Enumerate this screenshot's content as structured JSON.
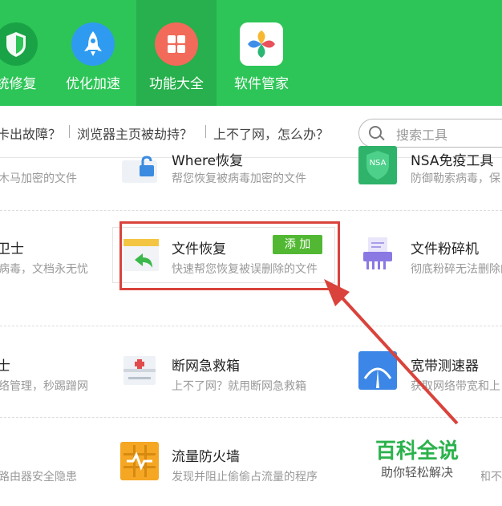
{
  "nav": {
    "items": [
      {
        "label": "统修复"
      },
      {
        "label": "优化加速"
      },
      {
        "label": "功能大全"
      },
      {
        "label": "软件管家"
      }
    ]
  },
  "quick_links": [
    "卡出故障？",
    "浏览器主页被劫持？",
    "上不了网，怎么办？"
  ],
  "search": {
    "placeholder": "搜索工具"
  },
  "tools": {
    "row0": {
      "left_desc": "木马加密的文件",
      "mid_name": "Where恢复",
      "mid_desc": "帮您恢复被病毒加密的文件",
      "right_name": "NSA免疫工具",
      "right_desc": "防御勒索病毒，保",
      "right_badge": "NSA"
    },
    "row1": {
      "left_name": "卫士",
      "left_desc": "病毒，文档永无忧",
      "mid_name": "文件恢复",
      "mid_desc": "快速帮您恢复被误删除的文件",
      "add_label": "添 加",
      "right_name": "文件粉碎机",
      "right_desc": "彻底粉碎无法删除的"
    },
    "row2": {
      "left_name": "士",
      "left_desc": "络管理，秒踢蹭网",
      "mid_name": "断网急救箱",
      "mid_desc": "上不了网？就用断网急救箱",
      "right_name": "宽带测速器",
      "right_desc": "获取网络带宽和上"
    },
    "row3": {
      "left_desc": "路由器安全隐患",
      "mid_name": "流量防火墙",
      "mid_desc": "发现并阻止偷偷占流量的程序",
      "right_desc": "和不"
    }
  },
  "watermark": {
    "title": "百科全说",
    "subtitle": "助你轻松解决"
  },
  "colors": {
    "brand_green": "#2dc557",
    "highlight_red": "#d9433c",
    "add_green": "#52b833"
  }
}
